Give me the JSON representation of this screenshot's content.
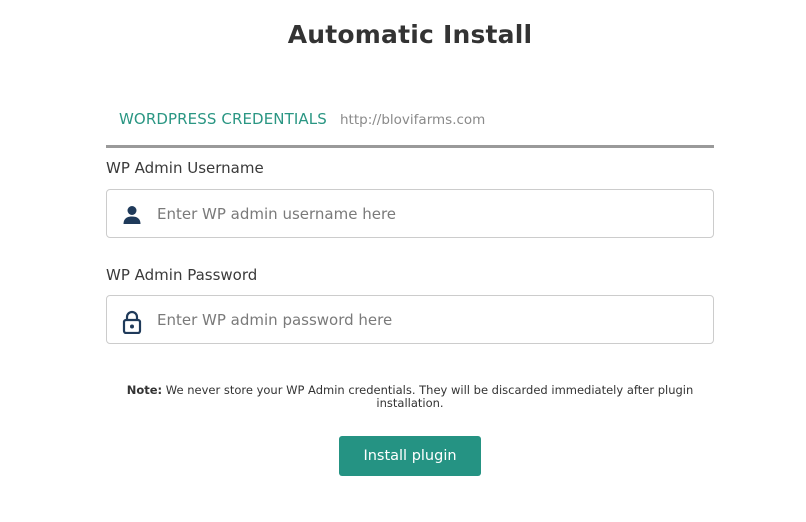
{
  "page": {
    "title": "Automatic Install"
  },
  "tabs": {
    "active_label": "WORDPRESS CREDENTIALS",
    "site_url": "http://blovifarms.com"
  },
  "form": {
    "username": {
      "label": "WP Admin Username",
      "placeholder": "Enter WP admin username here",
      "value": "",
      "icon": "user-icon"
    },
    "password": {
      "label": "WP Admin Password",
      "placeholder": "Enter WP admin password here",
      "value": "",
      "icon": "lock-icon"
    }
  },
  "note": {
    "prefix": "Note:",
    "text": " We never store your WP Admin credentials. They will be discarded immediately after plugin installation."
  },
  "actions": {
    "install_label": "Install plugin"
  },
  "colors": {
    "accent": "#259383",
    "tab_active": "#2a9683",
    "icon": "#1f3a5a"
  }
}
